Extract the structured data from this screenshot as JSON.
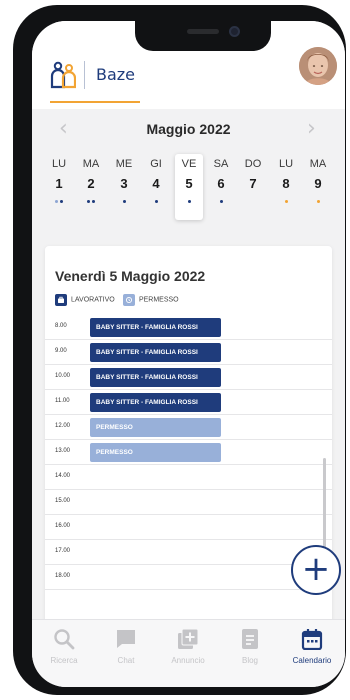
{
  "app": {
    "brand": "Baze",
    "colors": {
      "primary": "#1f3c7c",
      "accent": "#f2a434",
      "permesso": "#98b0d9",
      "inactive": "#c4c4c7"
    }
  },
  "calendar": {
    "month_title": "Maggio 2022",
    "prev_icon": "chevron-left-icon",
    "next_icon": "chevron-right-icon",
    "days": [
      {
        "name": "LU",
        "date": "1",
        "dots": [
          "#8ea6d3",
          "#1f3c7c"
        ],
        "selected": false
      },
      {
        "name": "MA",
        "date": "2",
        "dots": [
          "#1f3c7c",
          "#1f3c7c"
        ],
        "selected": false
      },
      {
        "name": "ME",
        "date": "3",
        "dots": [
          "#1f3c7c"
        ],
        "selected": false
      },
      {
        "name": "GI",
        "date": "4",
        "dots": [
          "#1f3c7c"
        ],
        "selected": false
      },
      {
        "name": "VE",
        "date": "5",
        "dots": [
          "#1f3c7c"
        ],
        "selected": true
      },
      {
        "name": "SA",
        "date": "6",
        "dots": [
          "#1f3c7c"
        ],
        "selected": false
      },
      {
        "name": "DO",
        "date": "7",
        "dots": [],
        "selected": false
      },
      {
        "name": "LU",
        "date": "8",
        "dots": [
          "#f2a434"
        ],
        "selected": false
      },
      {
        "name": "MA",
        "date": "9",
        "dots": [
          "#f2a434"
        ],
        "selected": false
      }
    ]
  },
  "day_view": {
    "title": "Venerdì 5 Maggio 2022",
    "legend": [
      {
        "label": "LAVORATIVO",
        "color": "#1f3c7c",
        "icon": "briefcase-icon"
      },
      {
        "label": "PERMESSO",
        "color": "#98b0d9",
        "icon": "calendar-icon"
      }
    ],
    "slots": [
      {
        "time": "8.00",
        "event": "BABY SITTER - FAMIGLIA ROSSI",
        "type": "lavorativo"
      },
      {
        "time": "9.00",
        "event": "BABY SITTER - FAMIGLIA ROSSI",
        "type": "lavorativo"
      },
      {
        "time": "10.00",
        "event": "BABY SITTER - FAMIGLIA ROSSI",
        "type": "lavorativo"
      },
      {
        "time": "11.00",
        "event": "BABY SITTER - FAMIGLIA ROSSI",
        "type": "lavorativo"
      },
      {
        "time": "12.00",
        "event": "PERMESSO",
        "type": "permesso"
      },
      {
        "time": "13.00",
        "event": "PERMESSO",
        "type": "permesso"
      },
      {
        "time": "14.00",
        "event": "",
        "type": ""
      },
      {
        "time": "15.00",
        "event": "",
        "type": ""
      },
      {
        "time": "16.00",
        "event": "",
        "type": ""
      },
      {
        "time": "17.00",
        "event": "",
        "type": ""
      },
      {
        "time": "18.00",
        "event": "",
        "type": ""
      }
    ]
  },
  "fab": {
    "icon": "plus-icon",
    "label": "+"
  },
  "bottom_nav": [
    {
      "label": "Ricerca",
      "icon": "search-icon",
      "active": false
    },
    {
      "label": "Chat",
      "icon": "chat-icon",
      "active": false
    },
    {
      "label": "Annuncio",
      "icon": "add-announcement-icon",
      "active": false
    },
    {
      "label": "Blog",
      "icon": "blog-icon",
      "active": false
    },
    {
      "label": "Calendario",
      "icon": "calendar-icon",
      "active": true
    }
  ]
}
